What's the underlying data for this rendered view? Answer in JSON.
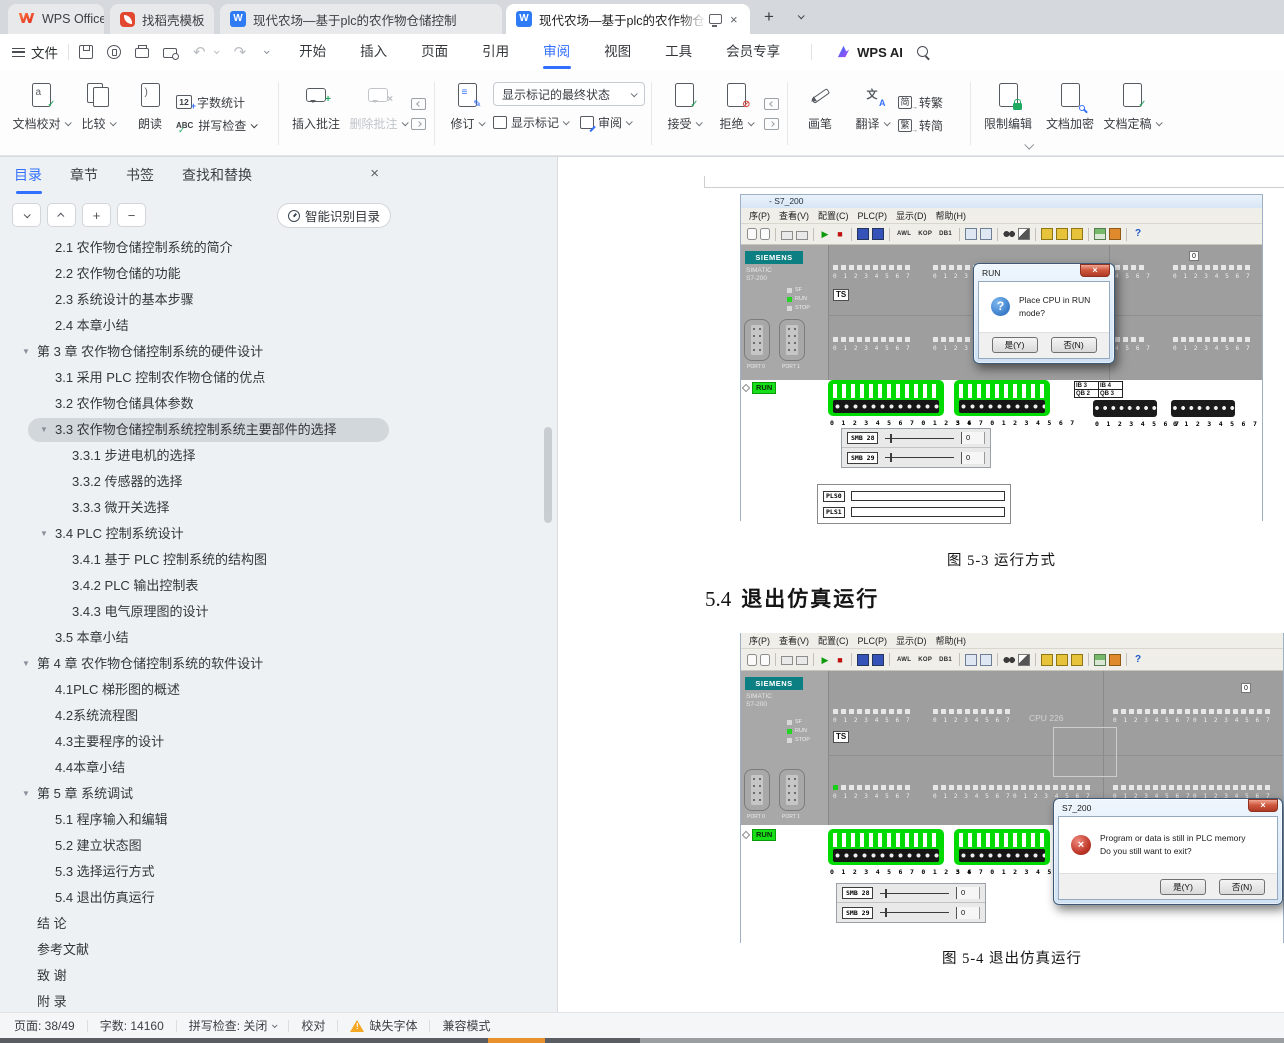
{
  "tabbar": {
    "tabs": [
      {
        "label": "WPS Office"
      },
      {
        "label": "找稻壳模板"
      },
      {
        "label": "现代农场—基于plc的农作物仓储控制"
      },
      {
        "label": "现代农场—基于plc的农作物仓"
      }
    ]
  },
  "menubar": {
    "file": "文件",
    "tabs": [
      "开始",
      "插入",
      "页面",
      "引用",
      "审阅",
      "视图",
      "工具",
      "会员专享"
    ],
    "active_tab": "审阅",
    "ai_label": "WPS AI"
  },
  "ribbon": {
    "doc_proof": "文档校对",
    "compare": "比较",
    "read_aloud": "朗读",
    "word_count": "字数统计",
    "word_count_badge": "12",
    "spell_badge": "ABC",
    "spell_check": "拼写检查",
    "insert_comment": "插入批注",
    "delete_comment": "删除批注",
    "revise": "修订",
    "markup_combo": "显示标记的最终状态",
    "show_markup": "显示标记",
    "review": "审阅",
    "accept": "接受",
    "reject": "拒绝",
    "pen": "画笔",
    "translate": "翻译",
    "s2t_icon": "简",
    "s2t": "转繁",
    "t2s_icon": "繁",
    "t2s": "转简",
    "restrict": "限制编辑",
    "encrypt": "文档加密",
    "finalize": "文档定稿"
  },
  "sidebar": {
    "tabs": [
      "目录",
      "章节",
      "书签",
      "查找和替换"
    ],
    "active_tab": "目录",
    "smart_toc": "智能识别目录",
    "items": [
      {
        "text": "2.1 农作物仓储控制系统的简介",
        "level": 2
      },
      {
        "text": "2.2 农作物仓储的功能",
        "level": 2
      },
      {
        "text": "2.3 系统设计的基本步骤",
        "level": 2
      },
      {
        "text": "2.4 本章小结",
        "level": 2
      },
      {
        "text": "第 3 章 农作物仓储控制系统的硬件设计",
        "level": 1,
        "arrow": true
      },
      {
        "text": "3.1 采用 PLC 控制农作物仓储的优点",
        "level": 2
      },
      {
        "text": "3.2 农作物仓储具体参数",
        "level": 2
      },
      {
        "text": "3.3 农作物仓储控制系统控制系统主要部件的选择",
        "level": 2,
        "arrow": true,
        "selected": true
      },
      {
        "text": "3.3.1 步进电机的选择",
        "level": 3
      },
      {
        "text": "3.3.2 传感器的选择",
        "level": 3
      },
      {
        "text": "3.3.3 微开关选择",
        "level": 3
      },
      {
        "text": "3.4 PLC 控制系统设计",
        "level": 2,
        "arrow": true
      },
      {
        "text": "3.4.1 基于 PLC 控制系统的结构图",
        "level": 3
      },
      {
        "text": "3.4.2 PLC 输出控制表",
        "level": 3
      },
      {
        "text": "3.4.3 电气原理图的设计",
        "level": 3
      },
      {
        "text": "3.5 本章小结",
        "level": 2
      },
      {
        "text": "第 4 章 农作物仓储控制系统的软件设计",
        "level": 1,
        "arrow": true
      },
      {
        "text": "4.1PLC 梯形图的概述",
        "level": 2
      },
      {
        "text": "4.2系统流程图",
        "level": 2
      },
      {
        "text": "4.3主要程序的设计",
        "level": 2
      },
      {
        "text": "4.4本章小结",
        "level": 2
      },
      {
        "text": "第 5 章 系统调试",
        "level": 1,
        "arrow": true
      },
      {
        "text": "5.1 程序输入和编辑",
        "level": 2
      },
      {
        "text": "5.2 建立状态图",
        "level": 2
      },
      {
        "text": "5.3 选择运行方式",
        "level": 2
      },
      {
        "text": "5.4 退出仿真运行",
        "level": 2
      },
      {
        "text": "结 论",
        "level": 1
      },
      {
        "text": "参考文献",
        "level": 1
      },
      {
        "text": "致 谢",
        "level": 1
      },
      {
        "text": "附 录",
        "level": 1
      }
    ]
  },
  "doc": {
    "fig53": "图 5-3 运行方式",
    "h54_num": "5.4",
    "h54_text": "退出仿真运行",
    "fig54": "图 5-4 退出仿真运行"
  },
  "sim": {
    "title": "- S7_200",
    "menus": [
      "序(P)",
      "查看(V)",
      "配置(C)",
      "PLC(P)",
      "显示(D)",
      "帮助(H)"
    ],
    "tb_text": [
      "AWL",
      "KOP",
      "DB1"
    ],
    "brand": "SIEMENS",
    "simatic": "SIMATIC",
    "model": "S7-200",
    "led_sf": "SF",
    "led_run": "RUN",
    "led_stop": "STOP",
    "ts": "TS",
    "run_badge": "RUN",
    "cpu": "CPU 226",
    "zero": "0",
    "digits8": "0 1 2 3 4 5 6 7",
    "digits_cut": "4 5 6 7",
    "green_digits_a": "0 1 2 3 4 5 6 7 0 1 2 3 4",
    "green_digits_b": "5 6 7 0 1 2 3 4 5 6 7",
    "green_digits_b_cut": "5 6 7 0 1 2 3 4 5",
    "io": [
      [
        "IB 3",
        "IB 4"
      ],
      [
        "QB 2",
        "QB 3"
      ]
    ],
    "smb28": "SMB 28",
    "smb29": "SMB 29",
    "smb_val": "0",
    "pls0": "PLS0",
    "pls1": "PLS1",
    "port0": "PORT 0",
    "port1": "PORT 1"
  },
  "dlg_run": {
    "title": "RUN",
    "msg": "Place CPU in RUN mode?",
    "yes": "是(Y)",
    "no": "否(N)"
  },
  "dlg_exit": {
    "title": "S7_200",
    "msg1": "Program or data is still in PLC memory",
    "msg2": "Do you still want to exit?",
    "yes": "是(Y)",
    "no": "否(N)"
  },
  "statusbar": {
    "page": "页面: 38/49",
    "words": "字数: 14160",
    "spell": "拼写检查: 关闭",
    "proof": "校对",
    "missing_font": "缺失字体",
    "compat": "兼容模式"
  }
}
